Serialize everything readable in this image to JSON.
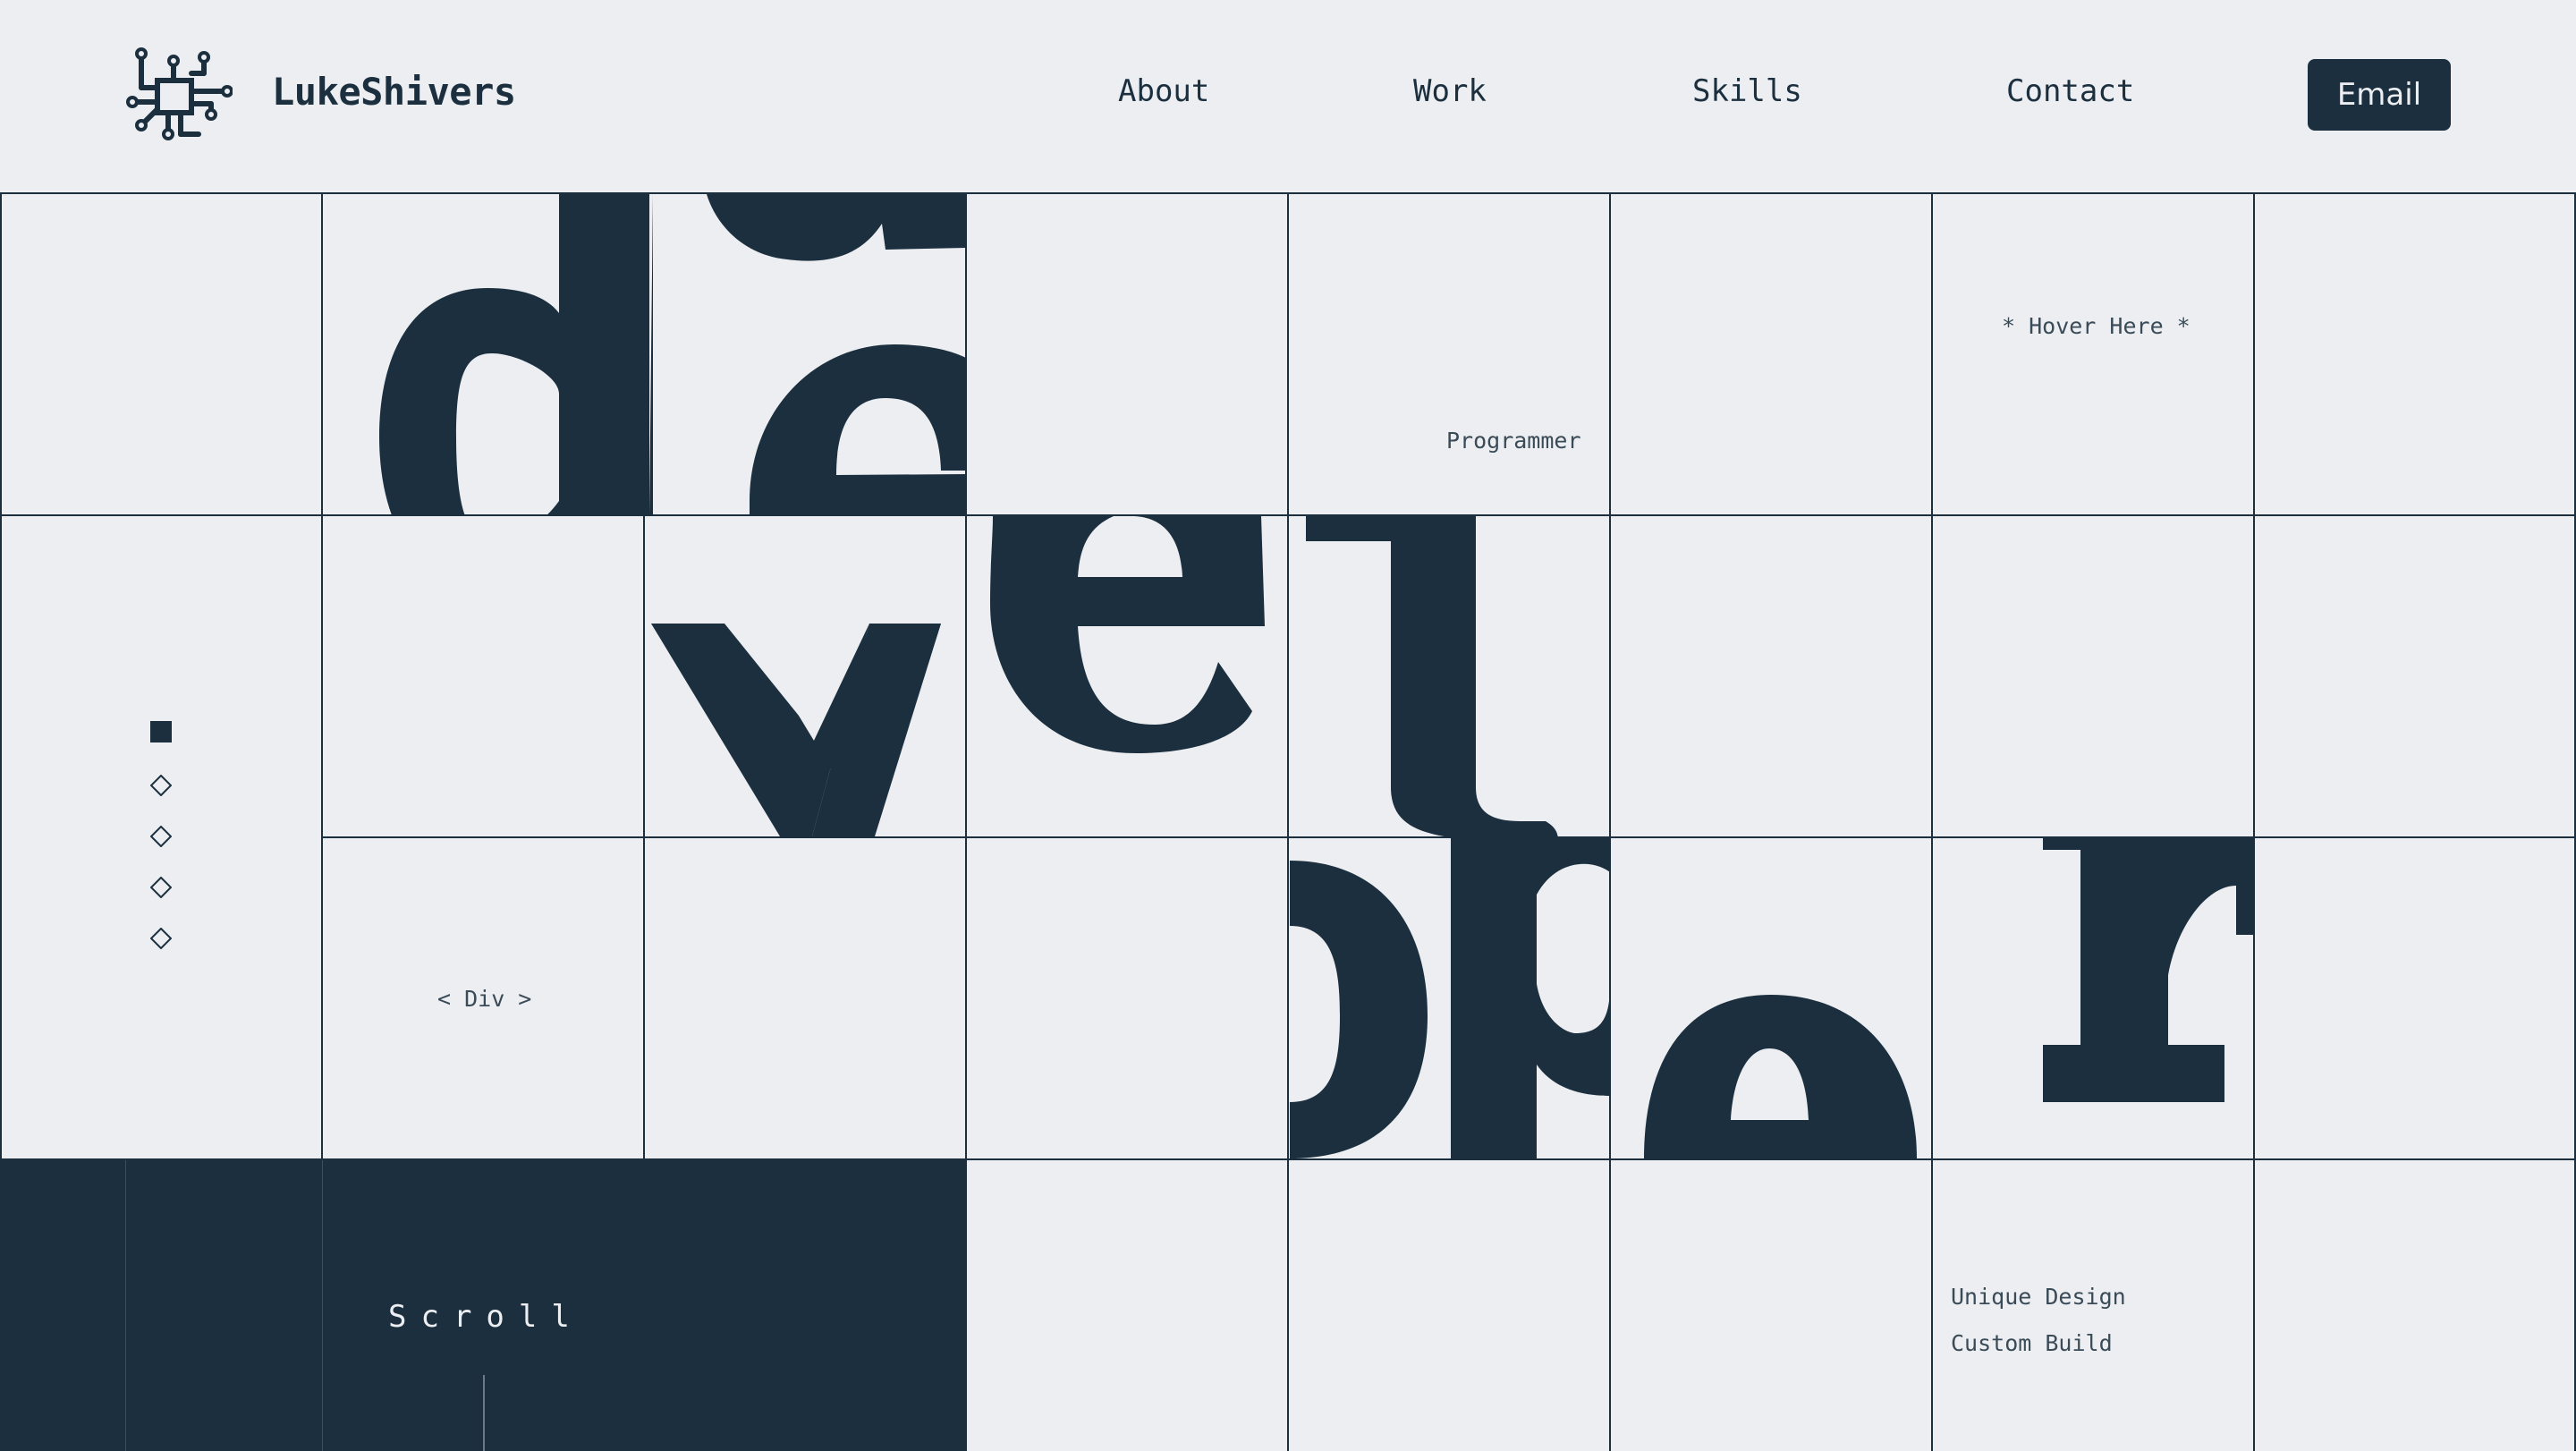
{
  "header": {
    "brand": "LukeShivers",
    "logo_icon": "circuit-chip-icon",
    "nav": [
      {
        "label": "About"
      },
      {
        "label": "Work"
      },
      {
        "label": "Skills"
      },
      {
        "label": "Contact"
      }
    ],
    "cta_label": "Email"
  },
  "hero": {
    "word": "developer",
    "labels": {
      "programmer": "Programmer",
      "hover": "* Hover Here *",
      "div_tag": "< Div >",
      "unique_design": "Unique Design",
      "custom_build": "Custom Build"
    },
    "scroll_label": "Scroll"
  },
  "pager": {
    "count": 5,
    "active_index": 0
  },
  "colors": {
    "background": "#eceef1",
    "ink": "#1b2f3f"
  }
}
